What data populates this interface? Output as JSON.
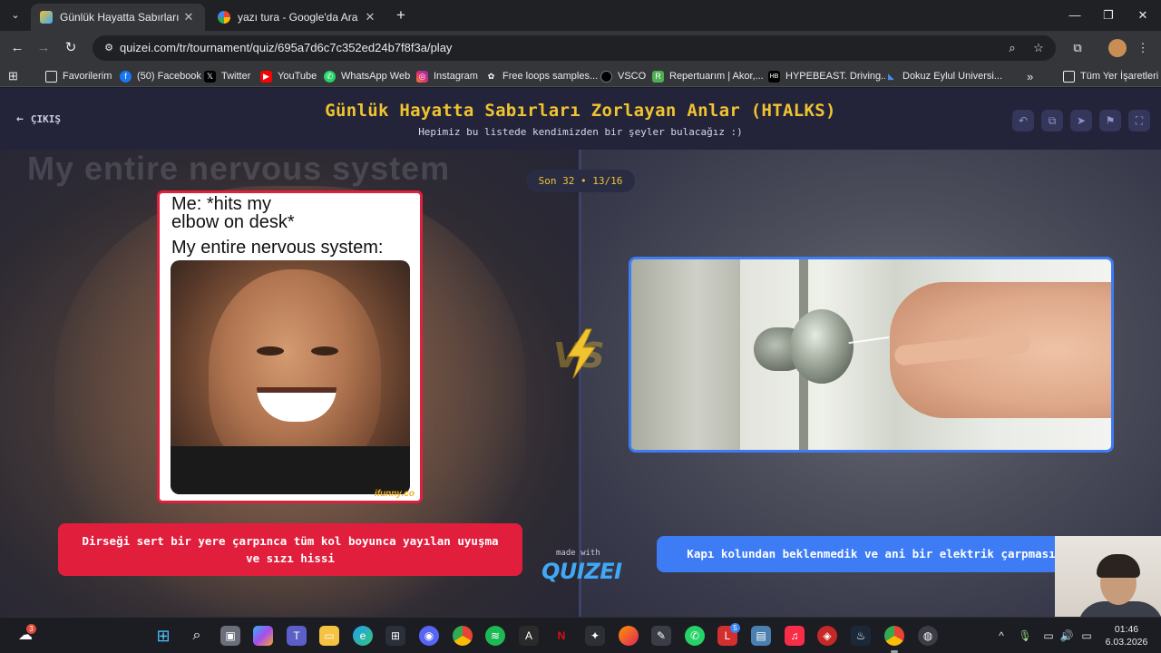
{
  "browser": {
    "tabs": [
      {
        "title": "Günlük Hayatta Sabırları Zorlayan",
        "active": true
      },
      {
        "title": "yazı tura - Google'da Ara",
        "active": false
      }
    ],
    "url": "quizei.com/tr/tournament/quiz/695a7d6c7c352ed24b7f8f3a/play",
    "bookmarks": [
      {
        "label": "Favorilerim",
        "icon": "folder-icon"
      },
      {
        "label": "(50) Facebook",
        "icon": "facebook-icon"
      },
      {
        "label": "Twitter",
        "icon": "x-icon"
      },
      {
        "label": "YouTube",
        "icon": "youtube-icon"
      },
      {
        "label": "WhatsApp Web",
        "icon": "whatsapp-icon"
      },
      {
        "label": "Instagram",
        "icon": "instagram-icon"
      },
      {
        "label": "Free loops samples...",
        "icon": "loop-icon"
      },
      {
        "label": "VSCO",
        "icon": "vsco-icon"
      },
      {
        "label": "Repertuarım | Akor,...",
        "icon": "repertuar-icon"
      },
      {
        "label": "HYPEBEAST. Driving...",
        "icon": "hypebeast-icon"
      },
      {
        "label": "Dokuz Eylul Universi...",
        "icon": "deu-icon"
      },
      {
        "label": "Tüm Yer İşaretleri",
        "icon": "folder-icon"
      }
    ],
    "bookmarks_overflow": "»"
  },
  "quiz": {
    "exit_label": "ÇIKIŞ",
    "title": "Günlük Hayatta Sabırları Zorlayan Anlar (HTALKS)",
    "subtitle": "Hepimiz bu listede kendimizden bir şeyler bulacağız :)",
    "round_badge": "Son 32 • 13/16",
    "left": {
      "meme_line1": "Me: *hits my",
      "meme_line2": "elbow on desk*",
      "meme_line3": "My entire nervous system:",
      "watermark": "ifunny.co",
      "bg_text": "My entire nervous system",
      "label": "Dirseği sert bir yere çarpınca tüm kol boyunca yayılan uyuşma ve sızı hissi",
      "color": "#e11f3d"
    },
    "right": {
      "label": "Kapı kolundan beklenmedik ve ani bir elektrik çarpması",
      "color": "#3d7cf5"
    },
    "vs_text": "VS",
    "made_with": "made with",
    "brand": "QUIZEI",
    "accent": "#f0c330"
  },
  "taskbar": {
    "weather_badge": "3",
    "calendar_badge": "5",
    "time": "01:46",
    "date": "6.03.2026"
  }
}
